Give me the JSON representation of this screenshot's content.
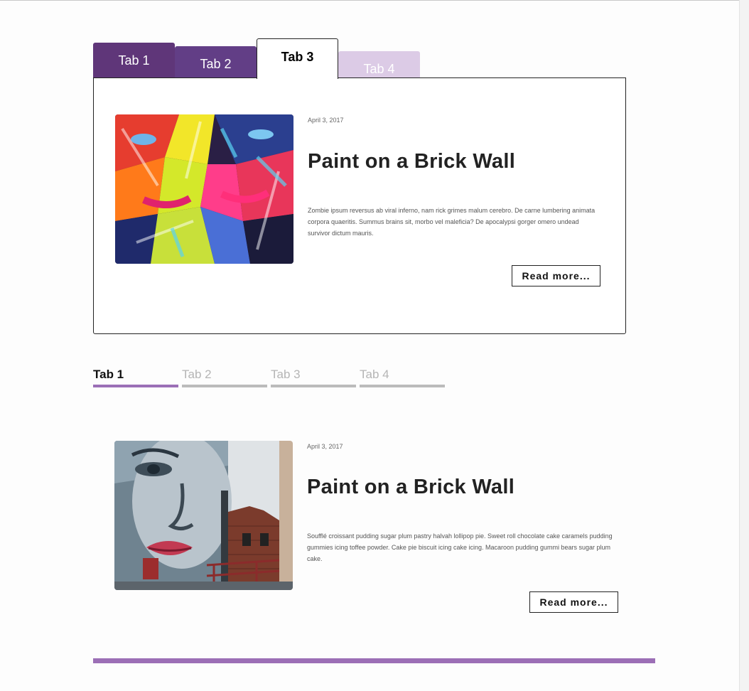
{
  "colors": {
    "tab1_bg": "#5f3679",
    "tab2_bg": "#623e86",
    "tab4_bg": "#dccbe6",
    "accent_purple": "#9c6fb6",
    "inactive_gray": "#bbbbbb"
  },
  "folder_tabs": [
    {
      "label": "Tab 1"
    },
    {
      "label": "Tab 2"
    },
    {
      "label": "Tab 3",
      "active": true
    },
    {
      "label": "Tab 4"
    }
  ],
  "post1": {
    "date": "April 3, 2017",
    "title": "Paint on a Brick Wall",
    "excerpt": "Zombie ipsum reversus ab viral inferno, nam rick grimes malum cerebro. De carne lumbering animata corpora quaeritis. Summus brains sit, morbo vel maleficia? De apocalypsi gorger omero undead survivor dictum mauris.",
    "button": "Read more..."
  },
  "line_tabs": [
    {
      "label": "Tab 1",
      "active": true
    },
    {
      "label": "Tab 2"
    },
    {
      "label": "Tab 3"
    },
    {
      "label": "Tab 4"
    }
  ],
  "post2": {
    "date": "April 3, 2017",
    "title": "Paint on a Brick Wall",
    "excerpt": "Soufflé croissant pudding sugar plum pastry halvah lollipop pie. Sweet roll chocolate cake caramels pudding gummies icing toffee powder. Cake pie biscuit icing cake icing. Macaroon pudding gummi bears sugar plum cake.",
    "button": "Read more..."
  }
}
